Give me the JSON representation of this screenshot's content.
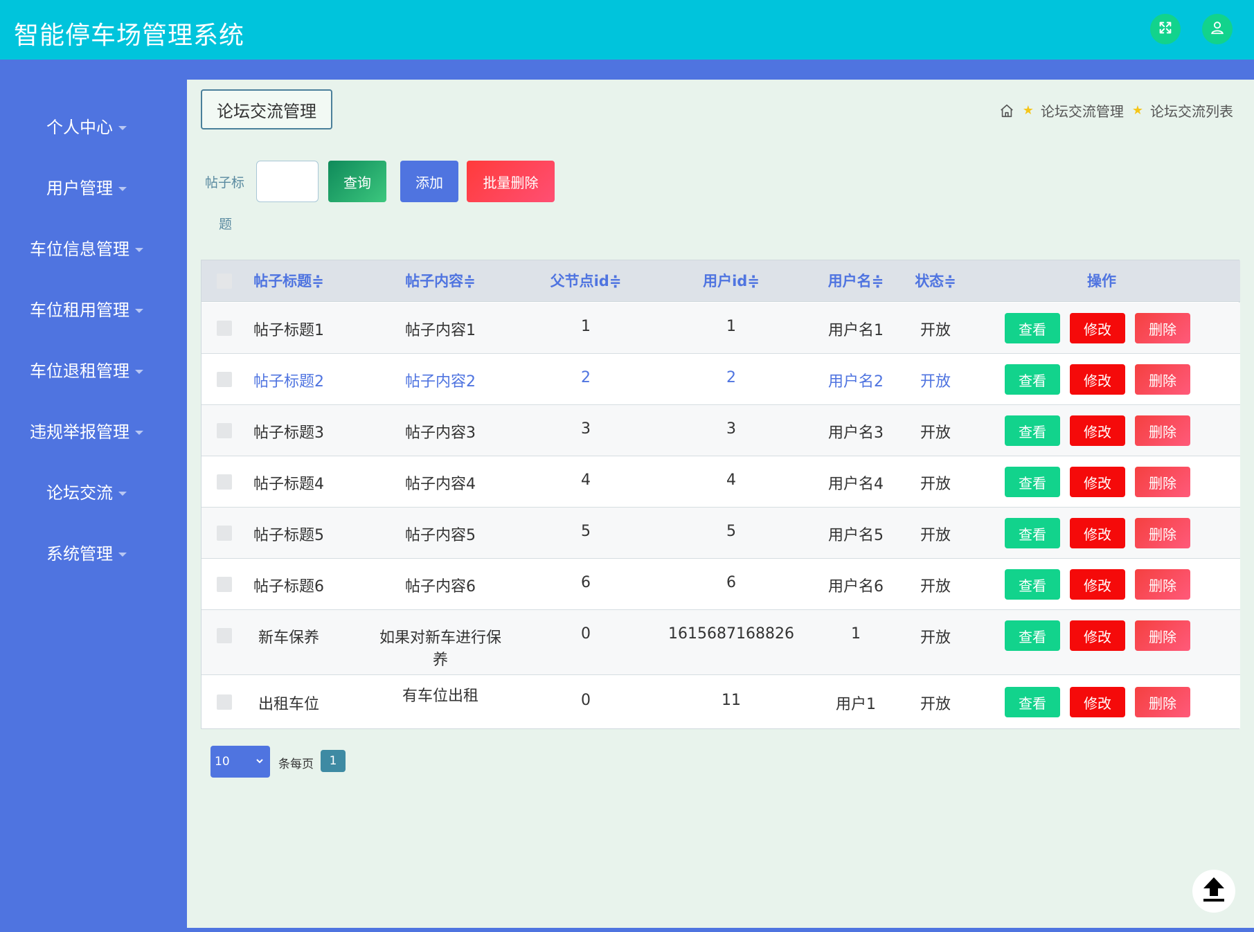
{
  "header": {
    "title": "智能停车场管理系统"
  },
  "icons": {
    "fullscreen": "expand-icon",
    "user": "user-icon",
    "home": "home-icon",
    "star": "star-icon",
    "upload": "scroll-top-icon"
  },
  "colors": {
    "topbar": "#00c4dc",
    "sidebar": "#4f74e0",
    "content_bg": "#e8f3ec",
    "accent": "#4f74e0",
    "view_btn": "#12d38c",
    "edit_btn": "#f50a0a",
    "delete_btn": "#f54040"
  },
  "sidebar": {
    "items": [
      {
        "label": "个人中心"
      },
      {
        "label": "用户管理"
      },
      {
        "label": "车位信息管理"
      },
      {
        "label": "车位租用管理"
      },
      {
        "label": "车位退租管理"
      },
      {
        "label": "违规举报管理"
      },
      {
        "label": "论坛交流"
      },
      {
        "label": "系统管理"
      }
    ]
  },
  "page": {
    "title": "论坛交流管理",
    "breadcrumb": [
      "论坛交流管理",
      "论坛交流列表"
    ]
  },
  "search": {
    "label_line1": "帖子标",
    "label_line2": "题",
    "value": "",
    "query_label": "查询",
    "add_label": "添加",
    "batch_delete_label": "批量删除"
  },
  "table": {
    "headers": {
      "title": "帖子标题≑",
      "content": "帖子内容≑",
      "parent_id": "父节点id≑",
      "user_id": "用户id≑",
      "username": "用户名≑",
      "status": "状态≑",
      "actions": "操作"
    },
    "action_labels": {
      "view": "查看",
      "edit": "修改",
      "delete": "删除"
    },
    "rows": [
      {
        "title": "帖子标题1",
        "content": "帖子内容1",
        "parent_id": "1",
        "user_id": "1",
        "username": "用户名1",
        "status": "开放"
      },
      {
        "title": "帖子标题2",
        "content": "帖子内容2",
        "parent_id": "2",
        "user_id": "2",
        "username": "用户名2",
        "status": "开放"
      },
      {
        "title": "帖子标题3",
        "content": "帖子内容3",
        "parent_id": "3",
        "user_id": "3",
        "username": "用户名3",
        "status": "开放"
      },
      {
        "title": "帖子标题4",
        "content": "帖子内容4",
        "parent_id": "4",
        "user_id": "4",
        "username": "用户名4",
        "status": "开放"
      },
      {
        "title": "帖子标题5",
        "content": "帖子内容5",
        "parent_id": "5",
        "user_id": "5",
        "username": "用户名5",
        "status": "开放"
      },
      {
        "title": "帖子标题6",
        "content": "帖子内容6",
        "parent_id": "6",
        "user_id": "6",
        "username": "用户名6",
        "status": "开放"
      },
      {
        "title": "新车保养",
        "content": "如果对新车进行保养",
        "parent_id": "0",
        "user_id": "1615687168826",
        "username": "1",
        "status": "开放"
      },
      {
        "title": "出租车位",
        "content": "有车位出租",
        "parent_id": "0",
        "user_id": "11",
        "username": "用户1",
        "status": "开放"
      }
    ]
  },
  "pagination": {
    "page_size": "10",
    "per_page_text": "条每页",
    "current_page": "1"
  }
}
